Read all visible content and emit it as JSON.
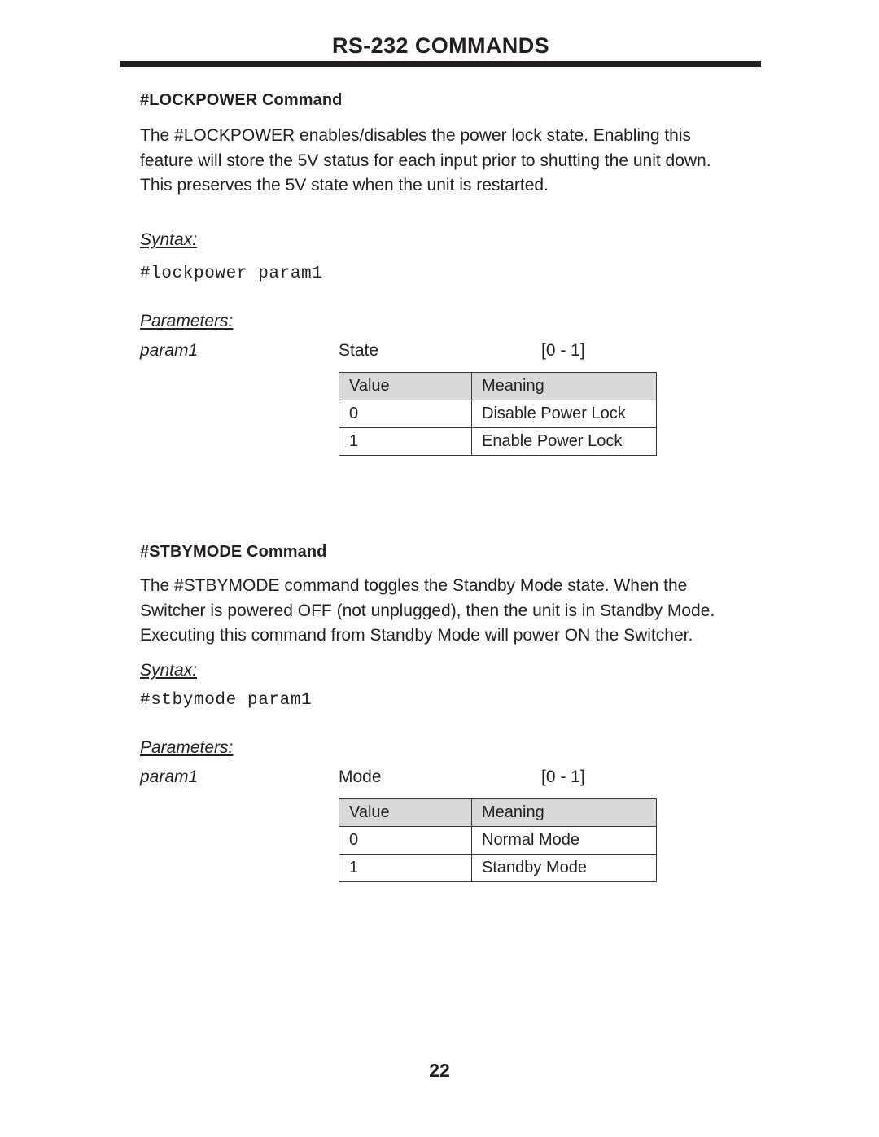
{
  "header": {
    "running_title": "RS-232 COMMANDS"
  },
  "sections": [
    {
      "heading": "#LOCKPOWER Command",
      "description": "The #LOCKPOWER enables/disables the power lock state.  Enabling this feature will store the 5V status for each input prior to shutting the unit down. This preserves the 5V state when the unit is restarted.",
      "syntax_label": "Syntax:",
      "syntax_command": "#lockpower param1",
      "parameters_label": "Parameters:",
      "param": {
        "name": "param1",
        "kind": "State",
        "range": "[0 - 1]"
      },
      "table": {
        "columns": [
          "Value",
          "Meaning"
        ],
        "rows": [
          [
            "0",
            "Disable Power Lock"
          ],
          [
            "1",
            "Enable Power Lock"
          ]
        ]
      }
    },
    {
      "heading": "#STBYMODE Command",
      "description": "The #STBYMODE command toggles the Standby Mode state.  When the Switcher is powered OFF (not unplugged), then the unit is in Standby Mode. Executing this command from Standby Mode will power ON the Switcher.",
      "syntax_label": "Syntax:",
      "syntax_command": "#stbymode param1",
      "parameters_label": "Parameters:",
      "param": {
        "name": "param1",
        "kind": "Mode",
        "range": "[0 - 1]"
      },
      "table": {
        "columns": [
          "Value",
          "Meaning"
        ],
        "rows": [
          [
            "0",
            "Normal Mode"
          ],
          [
            "1",
            "Standby Mode"
          ]
        ]
      }
    }
  ],
  "footer": {
    "page_number": "22"
  },
  "colors": {
    "ink": "#231f20",
    "table_header_fill": "#d9d9d9",
    "table_border": "#3a3238",
    "page_background": "#ffffff"
  }
}
